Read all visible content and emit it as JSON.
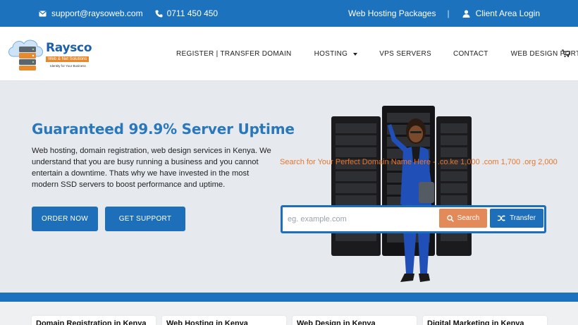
{
  "topbar": {
    "email": "support@raysoweb.com",
    "phone": "0711 450 450",
    "hosting_packages": "Web Hosting Packages",
    "separator": "|",
    "client_login": "Client Area Login"
  },
  "logo": {
    "brand": "Raysco",
    "tag": "Web & Net Solutions",
    "slogan": "Identity for Your Business"
  },
  "nav": {
    "items": [
      "REGISTER | TRANSFER DOMAIN",
      "HOSTING",
      "VPS SERVERS",
      "CONTACT",
      "WEB DESIGN PORTFOLIO"
    ]
  },
  "hero": {
    "headline": "Guaranteed 99.9% Server Uptime",
    "intro": "Web hosting, domain registration, web design services in Kenya. We understand that you are busy running a business and you cannot entertain a downtime. Thats why we have invested in the most modern SSD servers to boost performance and uptime.",
    "order_label": "ORDER NOW",
    "support_label": "GET SUPPORT"
  },
  "domain": {
    "promo": "Search for Your Perfect Domain Name Here - .co.ke 1,000 .com 1,700 .org 2,000",
    "placeholder": "eg. example.com",
    "search_label": "Search",
    "transfer_label": "Transfer"
  },
  "services": [
    "Domain Registration in Kenya",
    "Web Hosting in Kenya",
    "Web Design in Kenya",
    "Digital Marketing in Kenya"
  ],
  "colors": {
    "primary_blue": "#1d72bd",
    "accent_orange": "#e8742a",
    "search_orange": "#e38a5a"
  }
}
